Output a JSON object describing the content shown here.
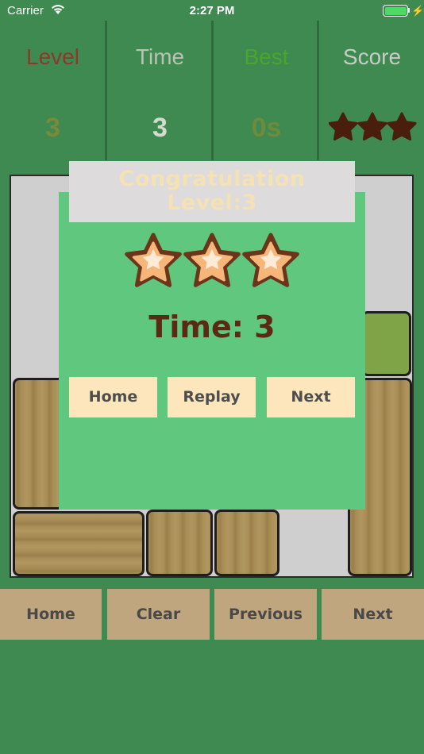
{
  "status_bar": {
    "carrier": "Carrier",
    "time": "2:27 PM"
  },
  "stats": {
    "level_label": "Level",
    "level_value": "3",
    "time_label": "Time",
    "time_value": "3",
    "best_label": "Best",
    "best_value": "0s",
    "score_label": "Score",
    "score_stars": 3
  },
  "dialog": {
    "title_line1": "Congratulation",
    "title_line2": "Level:3",
    "stars_earned": 3,
    "time_text": "Time: 3",
    "home_label": "Home",
    "replay_label": "Replay",
    "next_label": "Next"
  },
  "bottom_bar": {
    "home_label": "Home",
    "clear_label": "Clear",
    "previous_label": "Previous",
    "next_label": "Next"
  },
  "colors": {
    "background": "#3e8a50",
    "dialog": "#5fc77e",
    "button": "#fde6bb",
    "nav_button": "#bfa67f"
  }
}
